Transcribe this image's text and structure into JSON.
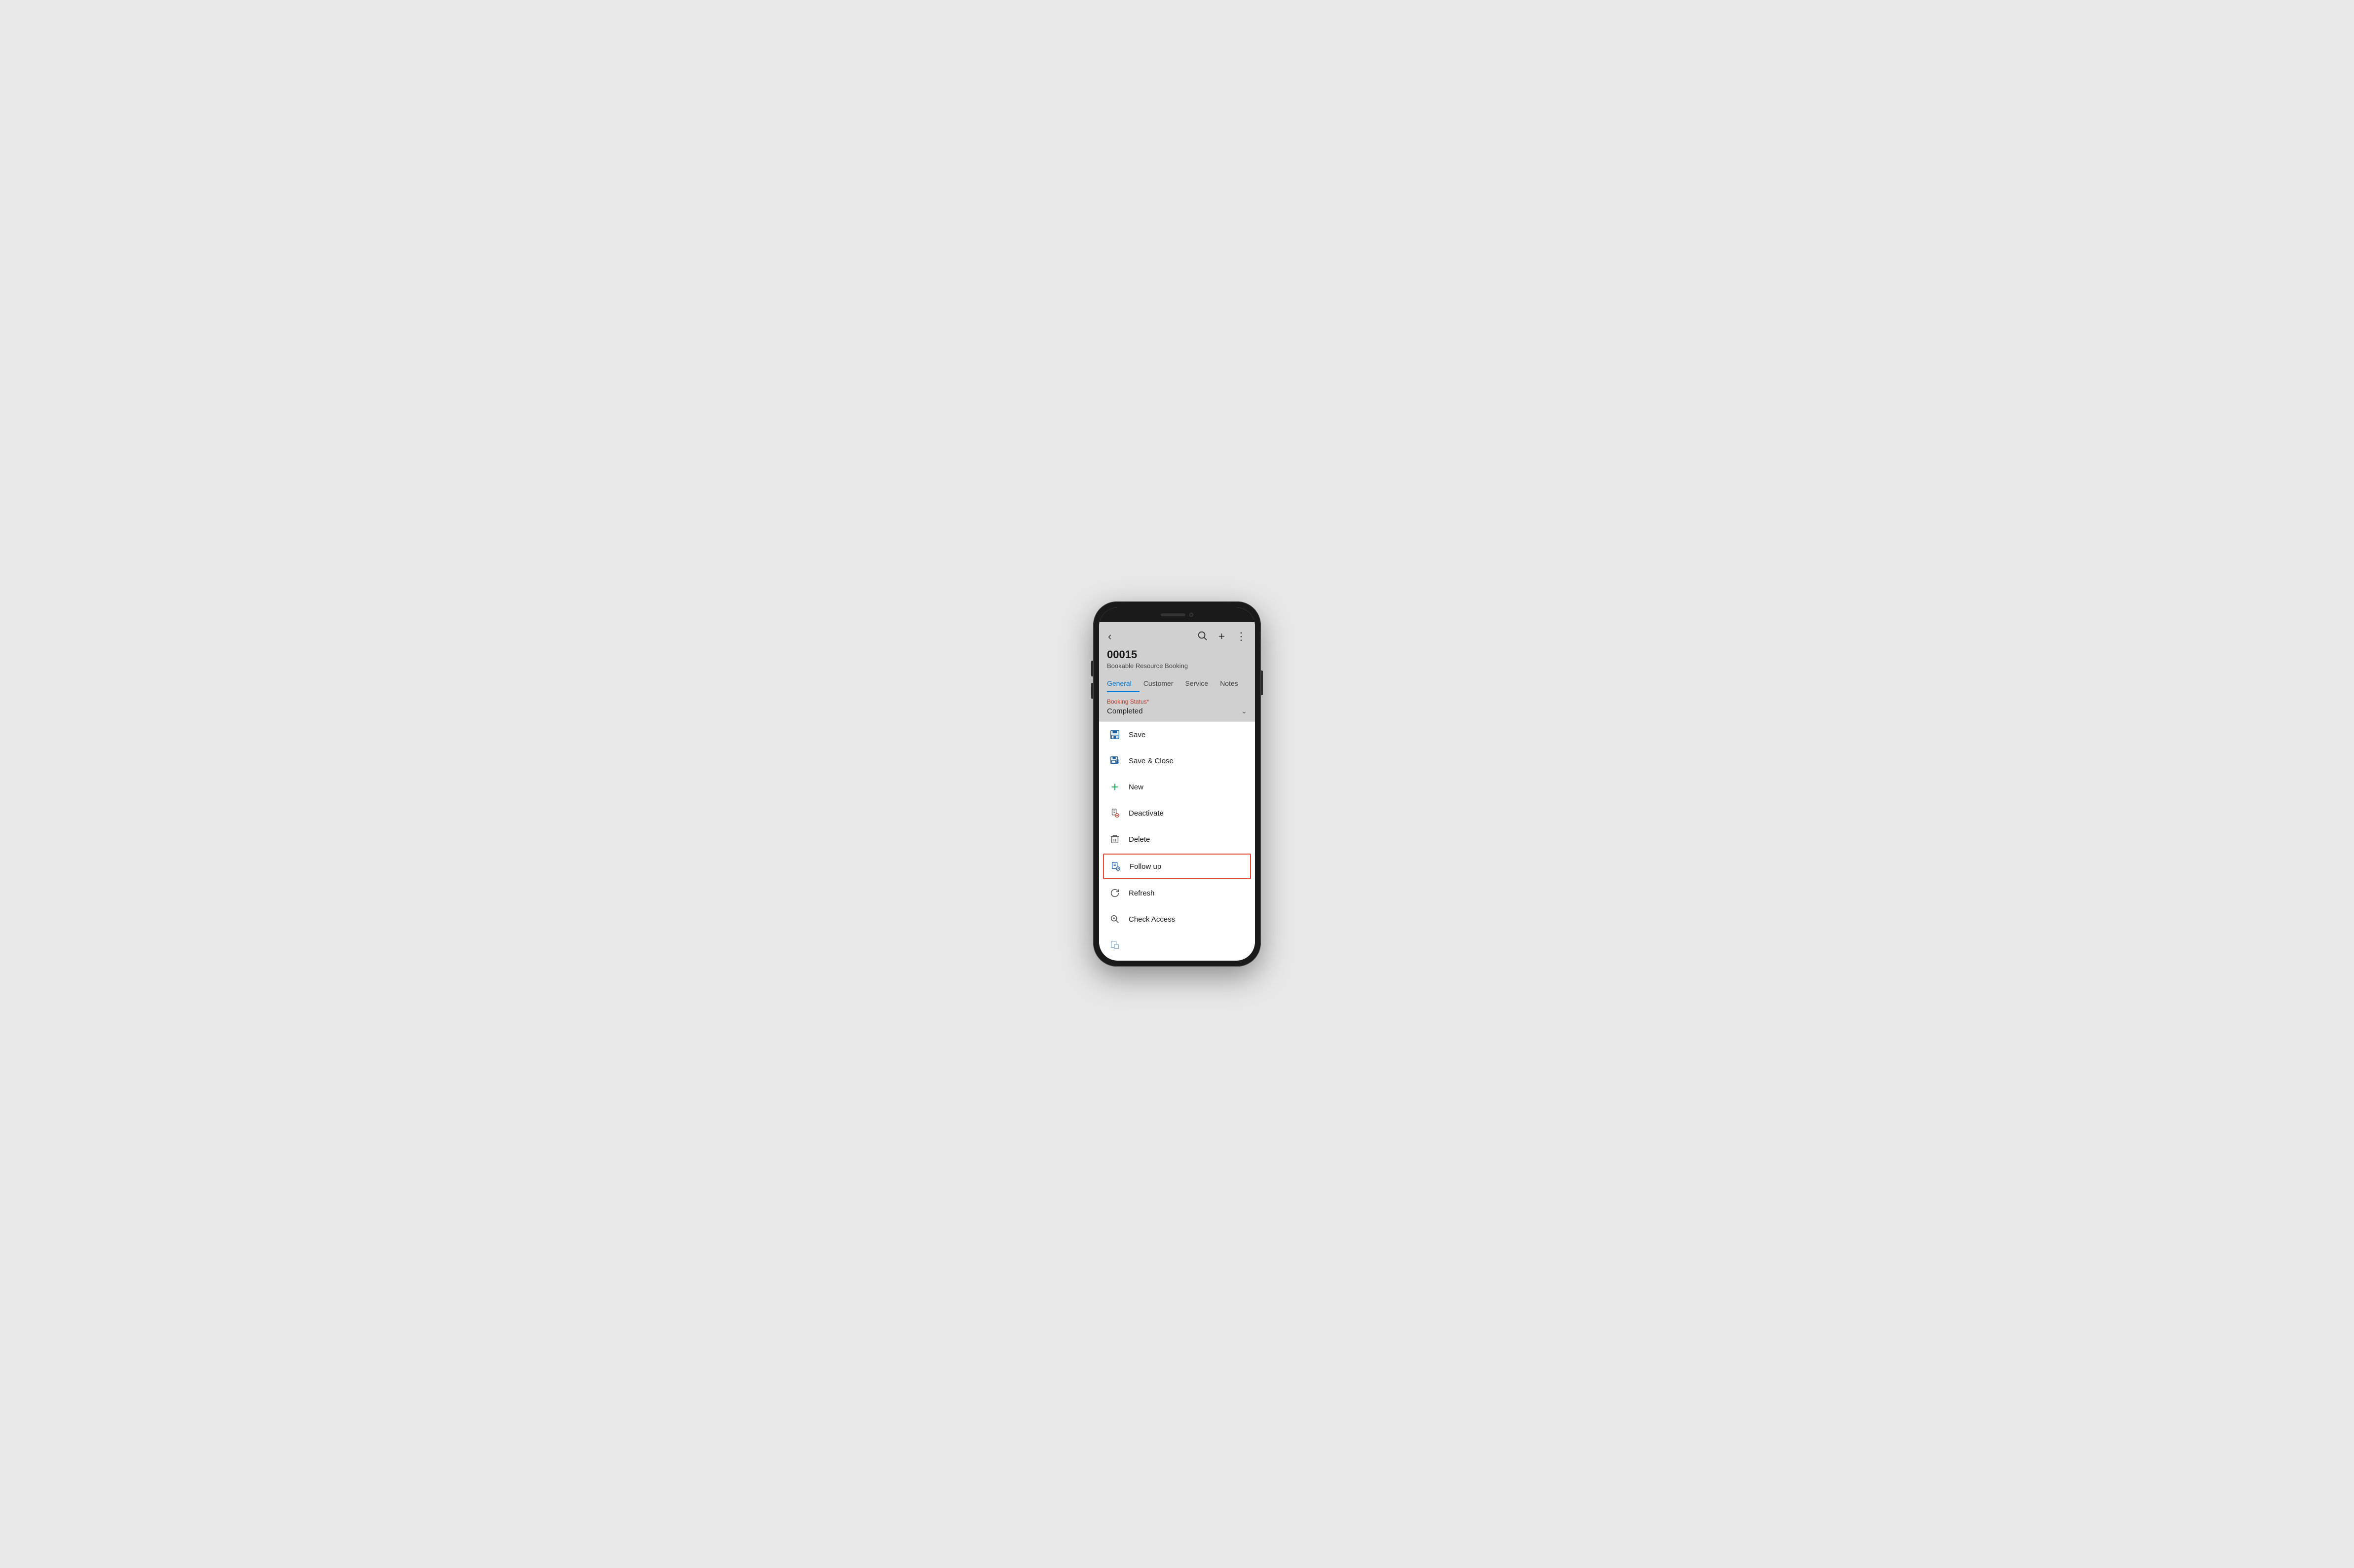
{
  "phone": {
    "record_id": "00015",
    "record_type": "Bookable Resource Booking"
  },
  "tabs": [
    {
      "label": "General",
      "active": true
    },
    {
      "label": "Customer",
      "active": false
    },
    {
      "label": "Service",
      "active": false
    },
    {
      "label": "Notes",
      "active": false
    }
  ],
  "booking_status": {
    "label": "Booking Status",
    "required": true,
    "value": "Completed"
  },
  "header_icons": {
    "back": "‹",
    "search": "⌕",
    "add": "+",
    "more": "⋮"
  },
  "menu_items": [
    {
      "id": "save",
      "label": "Save",
      "icon": "save",
      "highlighted": false
    },
    {
      "id": "save-close",
      "label": "Save & Close",
      "icon": "save-close",
      "highlighted": false
    },
    {
      "id": "new",
      "label": "New",
      "icon": "new",
      "highlighted": false
    },
    {
      "id": "deactivate",
      "label": "Deactivate",
      "icon": "deactivate",
      "highlighted": false
    },
    {
      "id": "delete",
      "label": "Delete",
      "icon": "delete",
      "highlighted": false
    },
    {
      "id": "follow-up",
      "label": "Follow up",
      "icon": "follow-up",
      "highlighted": true
    },
    {
      "id": "refresh",
      "label": "Refresh",
      "icon": "refresh",
      "highlighted": false
    },
    {
      "id": "check-access",
      "label": "Check Access",
      "icon": "check-access",
      "highlighted": false
    }
  ],
  "colors": {
    "accent": "#0078d4",
    "required_star": "#c0392b",
    "highlight_border": "#e74c3c",
    "new_icon": "#2ecc71",
    "header_bg": "#d0d0d0"
  }
}
